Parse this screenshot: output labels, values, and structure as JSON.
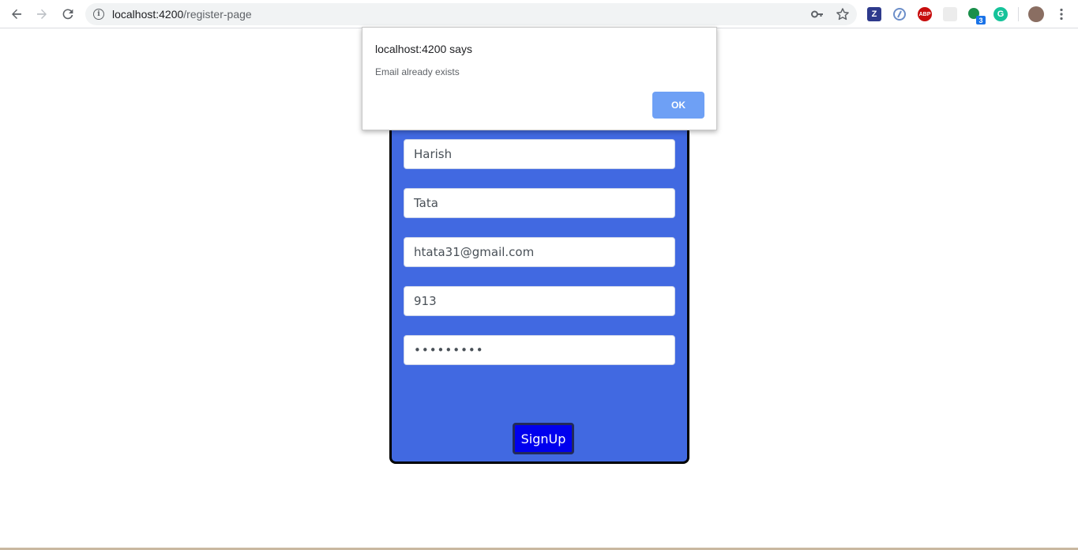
{
  "browser": {
    "url_host": "localhost:4200",
    "url_path": "/register-page",
    "extensions": [
      {
        "name": "zotero-extension",
        "label": "Z",
        "color": "#2e3a8c"
      },
      {
        "name": "ie-tab-extension",
        "label": "",
        "color": "#6c8ec9"
      },
      {
        "name": "adblock-extension",
        "label": "ABP",
        "color": "#c70d0d"
      },
      {
        "name": "generic-extension",
        "label": "",
        "color": "#e6e6e6"
      },
      {
        "name": "badge-extension",
        "label": "3",
        "color": "#1a8f4a"
      },
      {
        "name": "grammarly-extension",
        "label": "G",
        "color": "#15c39a"
      }
    ]
  },
  "form": {
    "first_name": "Harish",
    "last_name": "Tata",
    "email": "htata31@gmail.com",
    "phone": "913",
    "password": "•••••••••",
    "signup_label": "SignUp"
  },
  "alert": {
    "title": "localhost:4200 says",
    "message": "Email already exists",
    "ok_label": "OK"
  },
  "colors": {
    "card_bg": "#4169e1",
    "button_bg": "#0000ee",
    "ok_button": "#6ea0f5"
  }
}
